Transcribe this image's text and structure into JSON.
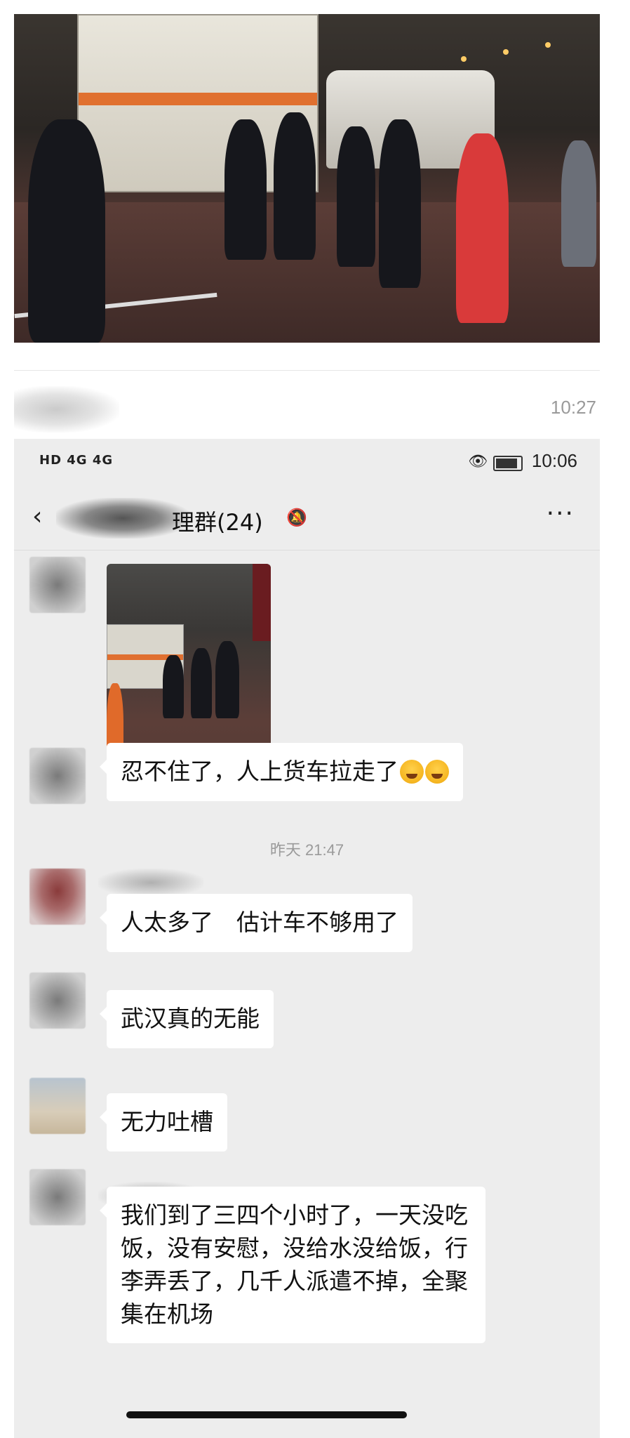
{
  "outer": {
    "time": "10:27"
  },
  "status_bar": {
    "left_icons": "HD 4G 4G",
    "time": "10:06"
  },
  "chat": {
    "title": "理群(24)",
    "more": "···",
    "timestamp": "昨天 21:47",
    "messages": [
      {
        "type": "image"
      },
      {
        "type": "text",
        "text": "忍不住了，人上货车拉走了",
        "emojis": [
          "crying-laughing-emoji",
          "crying-laughing-emoji"
        ]
      },
      {
        "type": "text",
        "text": "人太多了　估计车不够用了"
      },
      {
        "type": "text",
        "text": "武汉真的无能"
      },
      {
        "type": "text",
        "text": "无力吐槽"
      },
      {
        "type": "text",
        "text": "我们到了三四个小时了，一天没吃饭，没有安慰，没给水没给饭，行李弄丢了，几千人派遣不掉，全聚集在机场"
      }
    ]
  },
  "colors": {
    "chat_background": "#ededed",
    "bubble": "#ffffff",
    "timestamp": "#9a9a9a"
  }
}
